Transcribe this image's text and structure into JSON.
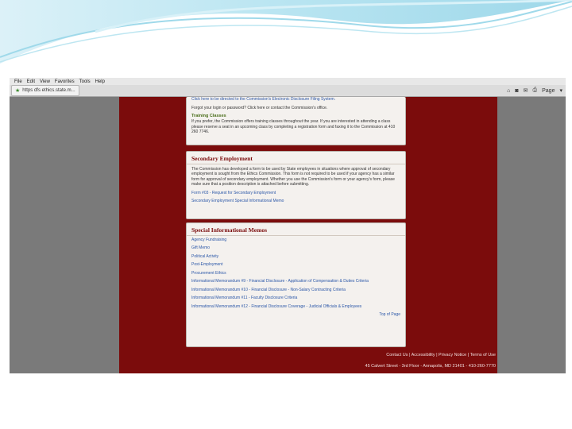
{
  "browser": {
    "menu": [
      "File",
      "Edit",
      "View",
      "Favorites",
      "Tools",
      "Help"
    ],
    "url": "https  dfs ethics.state.m...",
    "page_label": "Page",
    "icons": [
      "home-icon",
      "feeds-icon",
      "mail-icon",
      "print-icon",
      "page-menu-icon"
    ]
  },
  "panel1": {
    "line1": "Click here to be directed to the Commission's Electronic Disclosure Filing System.",
    "line2": "Forgot your login or password? Click here or contact the Commission's office.",
    "training_title": "Training Classes",
    "training_text": "If you prefer, the Commission offers training classes throughout the year. If you are interested in attending a class please reserve a seat in an upcoming class by completing a registration form and faxing it to the Commission at 410 260 7746."
  },
  "panel2": {
    "title": "Secondary Employment",
    "text": "The Commission has developed a form to be used by State employees in situations where approval of secondary employment is sought from the Ethics Commission. This form is not required to be used if your agency has a similar form for approval of secondary employment. Whether you use the Commission's form or your agency's form, please make sure that a position description is attached before submitting.",
    "link1": "Form #03 - Request for Secondary Employment",
    "link2": "Secondary Employment   Special Informational Memo"
  },
  "panel3": {
    "title": "Special Informational Memos",
    "links": [
      "Agency Fundraising",
      "Gift Memo",
      "Political Activity",
      "Post-Employment",
      "Procurement   Ethics",
      "Informational Memorandum #9 - Financial Disclosure - Application of Compensation & Duties Criteria",
      "Informational Memorandum #10 - Financial Disclosure - Non-Salary Contracting Criteria",
      "Informational Memorandum #11 - Faculty Disclosure Criteria",
      "Informational Memorandum #12 - Financial Disclosure Coverage - Judicial Officials & Employees"
    ],
    "top_link": "Top of Page"
  },
  "footer": {
    "links": "Contact Us  |  Accessibility  |  Privacy Notice  |  Terms of Use",
    "address": "45 Calvert Street - 3rd Floor - Annapolis, MD 21401 - 410-260-7770"
  }
}
